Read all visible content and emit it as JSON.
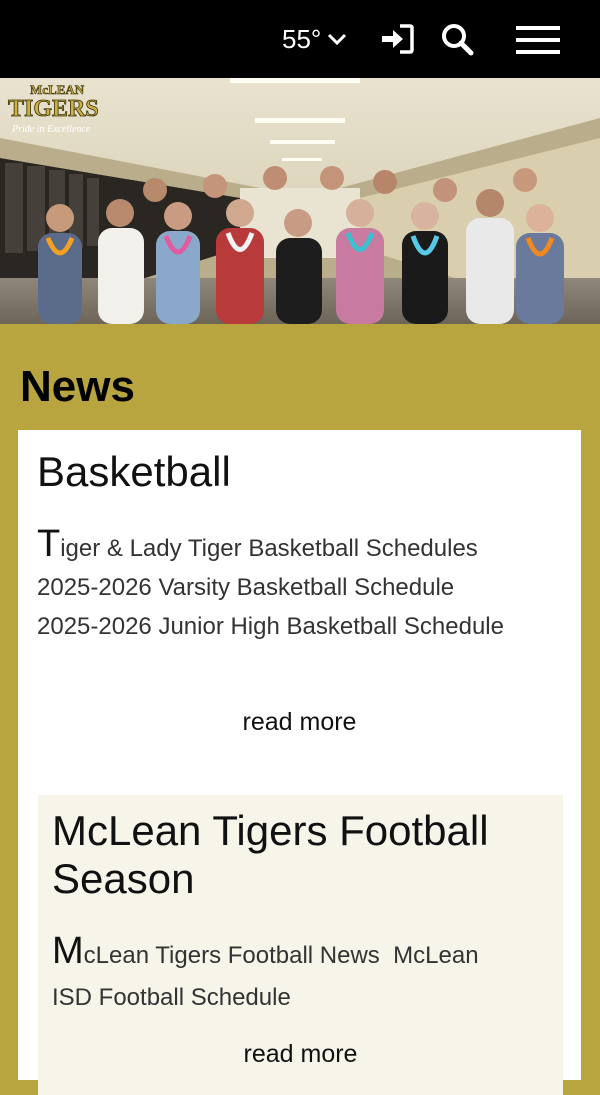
{
  "header": {
    "temperature": "55°",
    "icons": [
      "chevron-down-icon",
      "sign-in-icon",
      "search-icon",
      "hamburger-menu-icon"
    ]
  },
  "hero": {
    "logo_line1": "McLEAN",
    "logo_line2": "TIGERS",
    "logo_tagline": "Pride in Excellence"
  },
  "news": {
    "heading": "News",
    "articles": [
      {
        "title": "Basketball",
        "dropcap": "T",
        "lead": "iger & Lady Tiger Basketball Schedules",
        "lines": [
          "2025-2026 Varsity Basketball Schedule",
          "2025-2026 Junior High Basketball Schedule"
        ],
        "read_more": "read more"
      },
      {
        "title_line1": "McLean Tigers Football",
        "title_line2": "Season",
        "dropcap": "M",
        "lead": "cLean Tigers Football News",
        "lead2": "McLean",
        "line2": "ISD Football Schedule",
        "read_more": "read more"
      }
    ]
  },
  "colors": {
    "brand_gold": "#b8a540",
    "header_black": "#000000",
    "card_cream": "#f7f5ea"
  }
}
